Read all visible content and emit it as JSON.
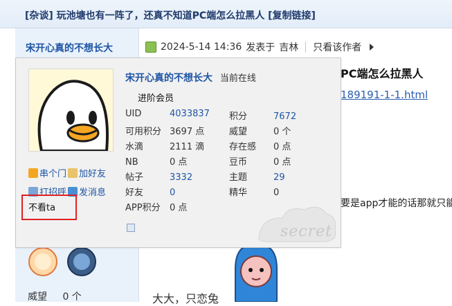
{
  "header": {
    "title": "[杂谈] 玩池塘也有一阵了，还真不知道PC端怎么拉黑人",
    "copy_link": "[复制链接]"
  },
  "left": {
    "author_name": "宋开心真的不想长大",
    "bottom_label": "威望",
    "bottom_value": "0 个"
  },
  "post": {
    "meta_date": "2024-5-14 14:36",
    "meta_posted_in": "发表于",
    "meta_location": "吉林",
    "only_author": "只看该作者",
    "title_partial": "PC端怎么拉黑人",
    "link_partial": "189191-1-1.html",
    "body_partial": "要是app才能的话那就只能",
    "bottom_partial": "大大，只恋兔"
  },
  "card": {
    "name": "宋开心真的不想长大",
    "online": "当前在线",
    "rank": "进阶会员",
    "stats": {
      "uid_label": "UID",
      "uid_value": "4033837",
      "jifen_label": "积分",
      "jifen_value": "7672",
      "kyjf_label": "可用积分",
      "kyjf_value": "3697 点",
      "weiwang_label": "威望",
      "weiwang_value": "0 个",
      "shuidi_label": "水滴",
      "shuidi_value": "2111 滴",
      "czg_label": "存在感",
      "czg_value": "0 点",
      "nb_label": "NB",
      "nb_value": "0 点",
      "doubi_label": "豆币",
      "doubi_value": "0 点",
      "tiezi_label": "帖子",
      "tiezi_value": "3332",
      "zhuti_label": "主题",
      "zhuti_value": "29",
      "haoyou_label": "好友",
      "haoyou_value": "0",
      "jinghua_label": "精华",
      "jinghua_value": "0",
      "app_label": "APP积分",
      "app_value": "0 点"
    },
    "actions": {
      "chuanmen": "串个门",
      "add_friend": "加好友",
      "greet": "打招呼",
      "message": "发消息",
      "block": "不看ta"
    },
    "watermark": "secret"
  },
  "colors": {
    "accent": "#1f55a5",
    "highlight_box": "#e02020"
  }
}
